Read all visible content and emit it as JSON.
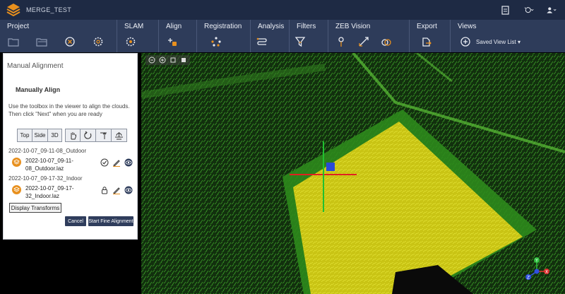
{
  "app": {
    "project_name": "MERGE_TEST",
    "colors": {
      "titlebar": "#1e2a44",
      "ribbon": "#2e3c5a",
      "accent_orange": "#e8901e",
      "button_dark": "#2f3d5c"
    }
  },
  "titlebar_icons": [
    "document-icon",
    "history-icon",
    "user-icon"
  ],
  "ribbon": {
    "groups": [
      {
        "label": "Project",
        "icons": [
          "open-folder-icon",
          "folder-icon",
          "close-circle-icon",
          "settings-gear-icon"
        ]
      },
      {
        "label": "SLAM",
        "icons": [
          "slam-gear-icon"
        ]
      },
      {
        "label": "Align",
        "icons": [
          "align-icon"
        ]
      },
      {
        "label": "Registration",
        "icons": [
          "registration-icon"
        ]
      },
      {
        "label": "Analysis",
        "icons": [
          "analysis-icon"
        ]
      },
      {
        "label": "Filters",
        "icons": [
          "filter-icon"
        ]
      },
      {
        "label": "ZEB Vision",
        "icons": [
          "pin-icon",
          "crop-icon",
          "overlap-icon"
        ]
      },
      {
        "label": "Export",
        "icons": [
          "export-icon"
        ]
      },
      {
        "label": "Views",
        "icons": [
          "add-view-icon"
        ]
      }
    ],
    "saved_view_list": "Saved View List"
  },
  "panel": {
    "title": "Manual Alignment",
    "subtitle": "Manually Align",
    "instructions": "Use the toolbox in the viewer to align the clouds. Then click \"Next\" when you are ready",
    "view_buttons": [
      "Top",
      "Side",
      "3D"
    ],
    "tool_icons": [
      "hand-pan-icon",
      "rotate-icon",
      "raise-icon",
      "level-icon"
    ],
    "clouds": [
      {
        "group": "2022-10-07_09-11-08_Outdoor",
        "name": "2022-10-07_09-11-08_Outdoor.laz",
        "icons": [
          "check-circle-icon",
          "edit-icon",
          "visibility-eye-icon"
        ]
      },
      {
        "group": "2022-10-07_09-17-32_Indoor",
        "name": "2022-10-07_09-17-32_Indoor.laz",
        "icons": [
          "lock-icon",
          "edit-icon",
          "visibility-eye-icon"
        ]
      }
    ],
    "display_transforms": "Display Transforms",
    "cancel": "Cancel",
    "start_fine_alignment": "Start Fine Alignment"
  },
  "viewer": {
    "toolbar_icons": [
      "zoom-out-icon",
      "zoom-in-icon",
      "view-square-icon",
      "stop-square-icon"
    ],
    "axis_labels": [
      "X",
      "Y",
      "Z"
    ]
  }
}
